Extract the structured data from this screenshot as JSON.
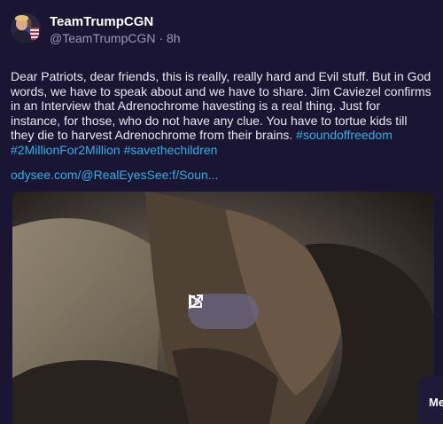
{
  "post": {
    "display_name": "TeamTrumpCGN",
    "handle": "@TeamTrumpCGN",
    "separator": " · ",
    "time": "8h",
    "body_lines": [
      "Dear Patriots, dear friends, this is really, really hard and Evil stuff. But in God",
      "words, we have to speak about and we have to share. Jim Caviezel confirms",
      "in an Interview that Adrenochrome havesting is a real thing. Just for instance,",
      "for those, who do not have any clue. You have to tortue kids till they die to",
      "harvest Adrenochrome from their brains."
    ],
    "hashtags": [
      "#soundoffreedom",
      "#2MillionFor2Million",
      "#savethechildren"
    ],
    "link": "odysee.com/@RealEyesSee:f/Soun..."
  },
  "side_card": {
    "label": "Me"
  },
  "icons": {
    "play": "play-icon",
    "external": "external-link-icon"
  },
  "colors": {
    "background": "#1a1533",
    "link": "#2fb0e8",
    "text": "#e9e8f2",
    "muted": "#9b98b5"
  }
}
